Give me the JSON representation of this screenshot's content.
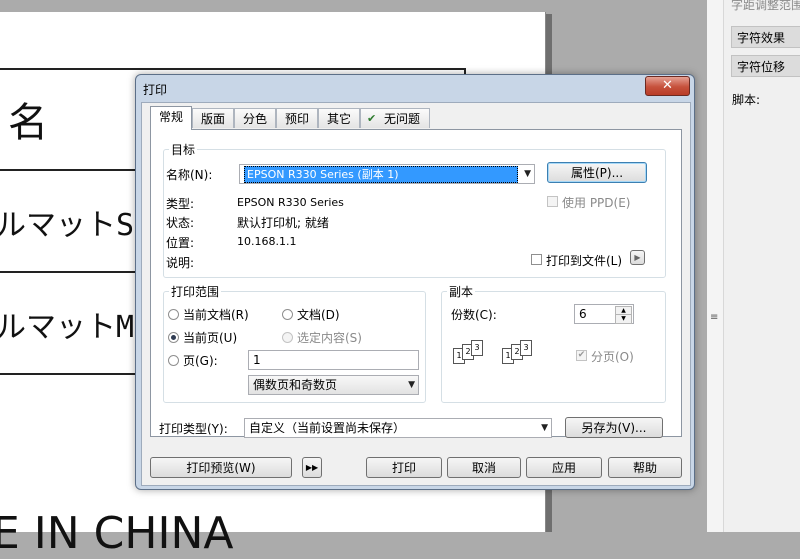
{
  "background_doc": {
    "row1_text": "名",
    "row2_text": "ルマットS ブ",
    "row3_text": "ルマットM ブ",
    "bottom_text": "E IN CHINA"
  },
  "side_panel": {
    "top_text": "字距调整范围",
    "tab1": "字符效果",
    "tab2": "字符位移",
    "script_label": "脚本:"
  },
  "dialog": {
    "title": "打印",
    "close_glyph": "✕",
    "tabs": [
      "常规",
      "版面",
      "分色",
      "预印",
      "其它",
      "无问题"
    ],
    "no_issues_icon": "✔",
    "destination": {
      "legend": "目标",
      "name_label": "名称(N):",
      "printer_value": "EPSON R330 Series (副本 1)",
      "properties_button": "属性(P)...",
      "type_label": "类型:",
      "type_value": "EPSON R330 Series",
      "status_label": "状态:",
      "status_value": "默认打印机; 就绪",
      "location_label": "位置:",
      "location_value": "10.168.1.1",
      "comment_label": "说明:",
      "use_ppd_label": "使用 PPD(E)",
      "print_to_file_label": "打印到文件(L)",
      "file_arrow": "▶"
    },
    "range": {
      "legend": "打印范围",
      "current_doc": "当前文档(R)",
      "documents": "文档(D)",
      "current_page": "当前页(U)",
      "selection": "选定内容(S)",
      "pages": "页(G):",
      "pages_value": "1",
      "page_set": "偶数页和奇数页"
    },
    "copies": {
      "legend": "副本",
      "count_label": "份数(C):",
      "count_value": "6",
      "collate_label": "分页(O)",
      "collate_check": "✔"
    },
    "print_type_label": "打印类型(Y):",
    "print_type_value": "自定义（当前设置尚未保存）",
    "save_as_button": "另存为(V)...",
    "preview_button": "打印预览(W)",
    "expand_glyph": "▶▶",
    "print_button": "打印",
    "cancel_button": "取消",
    "apply_button": "应用",
    "help_button": "帮助"
  }
}
